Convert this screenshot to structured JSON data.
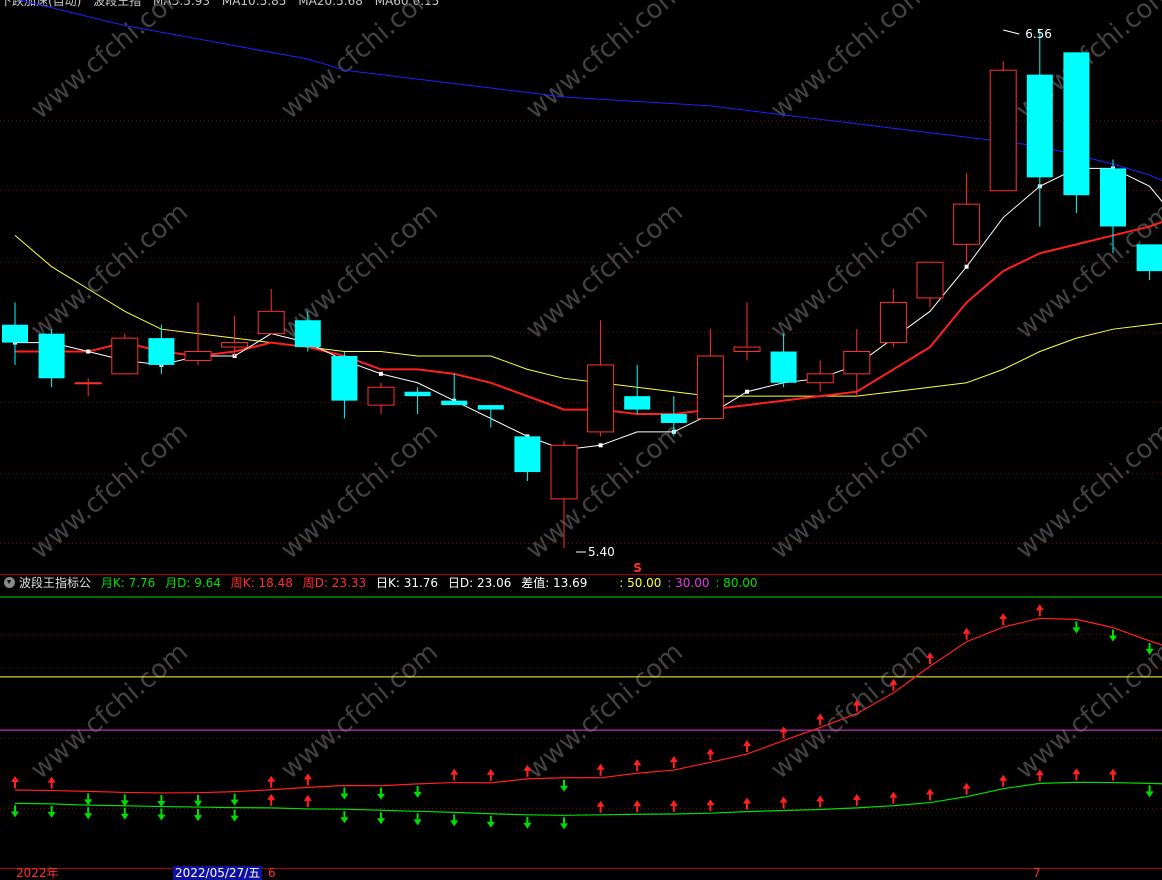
{
  "top_legend": {
    "items": [
      {
        "text": "下跌加速(自动)",
        "color": "#c8c8c8"
      },
      {
        "text": "波段王指",
        "color": "#c8c8c8"
      },
      {
        "text": "MA5:5.93",
        "color": "#ffffff"
      },
      {
        "text": "MA10:5.85",
        "color": "#ff2020"
      },
      {
        "text": "MA20:5.68",
        "color": "#ffff40"
      },
      {
        "text": "MA60:6.15",
        "color": "#4060ff"
      }
    ]
  },
  "main_chart": {
    "high_label": "6.56",
    "low_label": "5.40",
    "marker": "S",
    "candles": [
      [
        5.9,
        5.86,
        5.95,
        5.81
      ],
      [
        5.88,
        5.78,
        5.89,
        5.76
      ],
      [
        5.77,
        5.77,
        5.78,
        5.74
      ],
      [
        5.79,
        5.87,
        5.88,
        5.79
      ],
      [
        5.87,
        5.81,
        5.9,
        5.79
      ],
      [
        5.82,
        5.84,
        5.95,
        5.81
      ],
      [
        5.85,
        5.86,
        5.92,
        5.83
      ],
      [
        5.88,
        5.93,
        5.98,
        5.88
      ],
      [
        5.91,
        5.85,
        5.93,
        5.84
      ],
      [
        5.83,
        5.73,
        5.84,
        5.69
      ],
      [
        5.72,
        5.76,
        5.77,
        5.7
      ],
      [
        5.75,
        5.74,
        5.76,
        5.7
      ],
      [
        5.73,
        5.72,
        5.79,
        5.72
      ],
      [
        5.72,
        5.71,
        5.72,
        5.67
      ],
      [
        5.65,
        5.57,
        5.65,
        5.55
      ],
      [
        5.51,
        5.63,
        5.64,
        5.4
      ],
      [
        5.66,
        5.81,
        5.91,
        5.65
      ],
      [
        5.74,
        5.71,
        5.81,
        5.7
      ],
      [
        5.7,
        5.68,
        5.74,
        5.65
      ],
      [
        5.69,
        5.83,
        5.89,
        5.69
      ],
      [
        5.84,
        5.85,
        5.95,
        5.82
      ],
      [
        5.84,
        5.77,
        5.88,
        5.76
      ],
      [
        5.77,
        5.79,
        5.82,
        5.75
      ],
      [
        5.79,
        5.84,
        5.89,
        5.74
      ],
      [
        5.86,
        5.95,
        5.98,
        5.85
      ],
      [
        5.96,
        6.04,
        6.04,
        5.94
      ],
      [
        6.08,
        6.17,
        6.24,
        6.04
      ],
      [
        6.2,
        6.47,
        6.49,
        6.2
      ],
      [
        6.46,
        6.23,
        6.56,
        6.12
      ],
      [
        6.51,
        6.19,
        6.51,
        6.15
      ],
      [
        6.25,
        6.12,
        6.27,
        6.06
      ],
      [
        6.08,
        6.02,
        6.08,
        6.0
      ],
      [
        6.0,
        5.89,
        6.0,
        5.86
      ]
    ],
    "ma5": [
      5.86,
      5.86,
      5.84,
      5.82,
      5.81,
      5.83,
      5.83,
      5.88,
      5.86,
      5.82,
      5.79,
      5.77,
      5.73,
      5.69,
      5.65,
      5.62,
      5.63,
      5.66,
      5.66,
      5.7,
      5.75,
      5.77,
      5.78,
      5.81,
      5.87,
      5.93,
      6.03,
      6.14,
      6.21,
      6.25,
      6.25,
      6.21,
      6.11
    ],
    "ma10": [
      5.84,
      5.84,
      5.84,
      5.86,
      5.84,
      5.83,
      5.84,
      5.86,
      5.85,
      5.83,
      5.8,
      5.8,
      5.79,
      5.77,
      5.74,
      5.71,
      5.71,
      5.7,
      5.7,
      5.71,
      5.72,
      5.73,
      5.74,
      5.75,
      5.8,
      5.85,
      5.95,
      6.02,
      6.06,
      6.08,
      6.1,
      6.12,
      6.15
    ],
    "ma20": [
      6.1,
      6.03,
      5.98,
      5.93,
      5.89,
      5.88,
      5.87,
      5.86,
      5.85,
      5.84,
      5.84,
      5.83,
      5.83,
      5.83,
      5.8,
      5.78,
      5.77,
      5.76,
      5.75,
      5.74,
      5.74,
      5.74,
      5.74,
      5.74,
      5.75,
      5.76,
      5.77,
      5.8,
      5.84,
      5.87,
      5.89,
      5.9,
      5.91
    ],
    "ma60": [
      6.63,
      6.61,
      6.59,
      6.57,
      6.555,
      6.54,
      6.525,
      6.51,
      6.495,
      6.47,
      6.46,
      6.45,
      6.44,
      6.43,
      6.42,
      6.41,
      6.405,
      6.4,
      6.395,
      6.39,
      6.38,
      6.37,
      6.36,
      6.35,
      6.34,
      6.33,
      6.32,
      6.31,
      6.3,
      6.28,
      6.26,
      6.235,
      6.2
    ]
  },
  "indicator": {
    "name": "波段王指标公",
    "labels": [
      {
        "text": "月K: 7.76",
        "color": "#00e000"
      },
      {
        "text": "月D: 9.64",
        "color": "#00e000"
      },
      {
        "text": "周K: 18.48",
        "color": "#ff3030"
      },
      {
        "text": "周D: 23.33",
        "color": "#ff3030"
      },
      {
        "text": "日K: 31.76",
        "color": "#ffffff"
      },
      {
        "text": "日D: 23.06",
        "color": "#ffffff"
      },
      {
        "text": "差值: 13.69",
        "color": "#ffffff"
      }
    ],
    "levels": [
      {
        "text": ": 50.00",
        "value": 50,
        "color": "#ffff40"
      },
      {
        "text": ": 30.00",
        "value": 30,
        "color": "#e040e0"
      },
      {
        "text": ": 80.00",
        "value": 80,
        "color": "#00e000"
      }
    ],
    "weekly_line": [
      7.5,
      7.3,
      7.0,
      6.6,
      6.4,
      6.5,
      6.9,
      7.6,
      8.5,
      9.2,
      9.1,
      9.8,
      10.3,
      10.2,
      11.7,
      12.1,
      12.1,
      13.8,
      15.0,
      17.9,
      21.0,
      26.1,
      31.0,
      36.2,
      44.0,
      54.0,
      63.2,
      68.7,
      72.0,
      71.6,
      68.5,
      63.5,
      59.0
    ],
    "monthly_line": [
      2.5,
      2.3,
      1.8,
      1.6,
      1.3,
      1.1,
      0.9,
      0.8,
      0.4,
      0.3,
      -0.1,
      -0.5,
      -0.9,
      -1.4,
      -1.8,
      -2.0,
      -1.8,
      -1.6,
      -1.5,
      -1.2,
      -0.6,
      -0.2,
      0.2,
      0.8,
      1.6,
      2.8,
      5.0,
      8.0,
      10.0,
      10.4,
      10.3,
      10.0,
      9.6
    ],
    "weekly_arrows": [
      "up",
      "up",
      "down",
      "down",
      "down",
      "down",
      "down",
      "up",
      "up",
      "down",
      "down",
      "down",
      "up",
      "up",
      "up",
      "down",
      "up",
      "up",
      "up",
      "up",
      "up",
      "up",
      "up",
      "up",
      "up",
      "up",
      "up",
      "up",
      "up",
      "down",
      "down",
      "down",
      "down"
    ],
    "monthly_arrows": [
      "down",
      "down",
      "down",
      "down",
      "down",
      "down",
      "down",
      "up",
      "up",
      "down",
      "down",
      "down",
      "down",
      "down",
      "down",
      "down",
      "up",
      "up",
      "up",
      "up",
      "up",
      "up",
      "up",
      "up",
      "up",
      "up",
      "up",
      "up",
      "up",
      "up",
      "up",
      "down",
      "down"
    ]
  },
  "date_axis": {
    "labels": [
      {
        "text": "2022年",
        "color": "#ff3030"
      },
      {
        "text": "2022/05/27/五",
        "color": "#ffffff"
      },
      {
        "text": "6",
        "color": "#ff3030"
      },
      {
        "text": "7",
        "color": "#ff3030"
      }
    ]
  },
  "watermark": "www.cfchi.com",
  "colors": {
    "up": "#ff3030",
    "down": "#00ffff",
    "grid": "#8a0000",
    "ma5": "#ffffff",
    "ma10": "#ff2020",
    "ma20": "#ffff40",
    "ma60": "#2020ff"
  }
}
